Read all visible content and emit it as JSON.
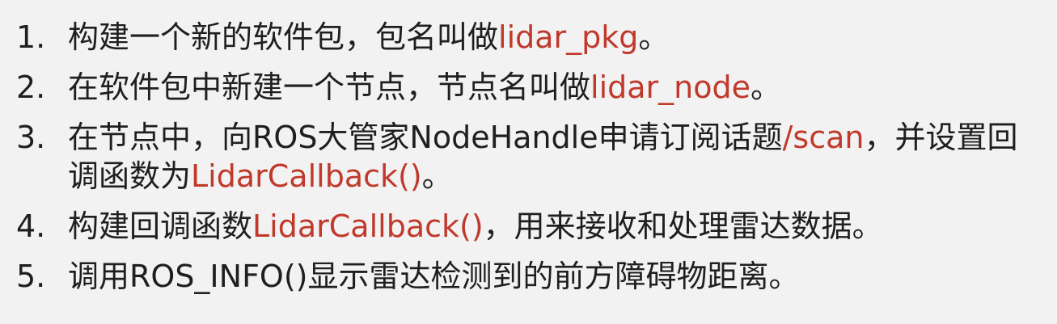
{
  "colors": {
    "background": "#f2f2f2",
    "text": "#1f1f1f",
    "accent": "#c0392b"
  },
  "steps": [
    {
      "number": "1.",
      "before": "构建一个新的软件包，包名叫做",
      "highlight": "lidar_pkg",
      "after": "。"
    },
    {
      "number": "2.",
      "before": "在软件包中新建一个节点，节点名叫做",
      "highlight": "lidar_node",
      "after": "。"
    },
    {
      "number": "3.",
      "before": "在节点中，向ROS大管家NodeHandle申请订阅话题",
      "highlight": "/scan",
      "middle": "，并设置回调函数为",
      "highlight2": "LidarCallback()",
      "after": "。"
    },
    {
      "number": "4.",
      "before": "构建回调函数",
      "highlight": "LidarCallback()",
      "after": "，用来接收和处理雷达数据。"
    },
    {
      "number": "5.",
      "before": "调用ROS_INFO()显示雷达检测到的前方障碍物距离。"
    }
  ]
}
